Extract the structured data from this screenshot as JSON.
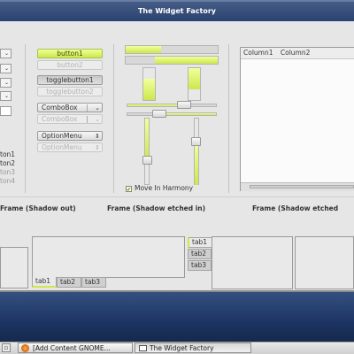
{
  "window": {
    "title": "The Widget Factory"
  },
  "left_column": {
    "labels": [
      "ton1",
      "ton2",
      "ton3",
      "ton4"
    ]
  },
  "buttons": {
    "button1": "button1",
    "button2": "button2",
    "togglebutton1": "togglebutton1",
    "togglebutton2": "togglebutton2",
    "combobox1": "ComboBox",
    "combobox2": "ComboBox",
    "optionmenu1": "OptionMenu",
    "optionmenu2": "OptionMenu"
  },
  "sliders": {
    "move_in_harmony_label": "Move In Harmony",
    "move_in_harmony_checked": true
  },
  "treeview": {
    "columns": [
      "Column1",
      "Column2"
    ]
  },
  "frames": {
    "labels": [
      "Frame (Shadow out)",
      "Frame (Shadow etched in)",
      "Frame (Shadow etched"
    ]
  },
  "notebooks": {
    "bottom_tabs": [
      "tab1",
      "tab2",
      "tab3"
    ],
    "left_tabs": [
      "tab1",
      "tab2",
      "tab3"
    ]
  },
  "taskbar": {
    "items": [
      {
        "label": "[Add Content GNOME...",
        "icon": "browser-icon"
      },
      {
        "label": "The Widget Factory",
        "icon": "window-icon"
      }
    ]
  },
  "colors": {
    "accent": "#cbe84d",
    "title_bar": "#2b4170",
    "desktop": "#1d3563"
  }
}
